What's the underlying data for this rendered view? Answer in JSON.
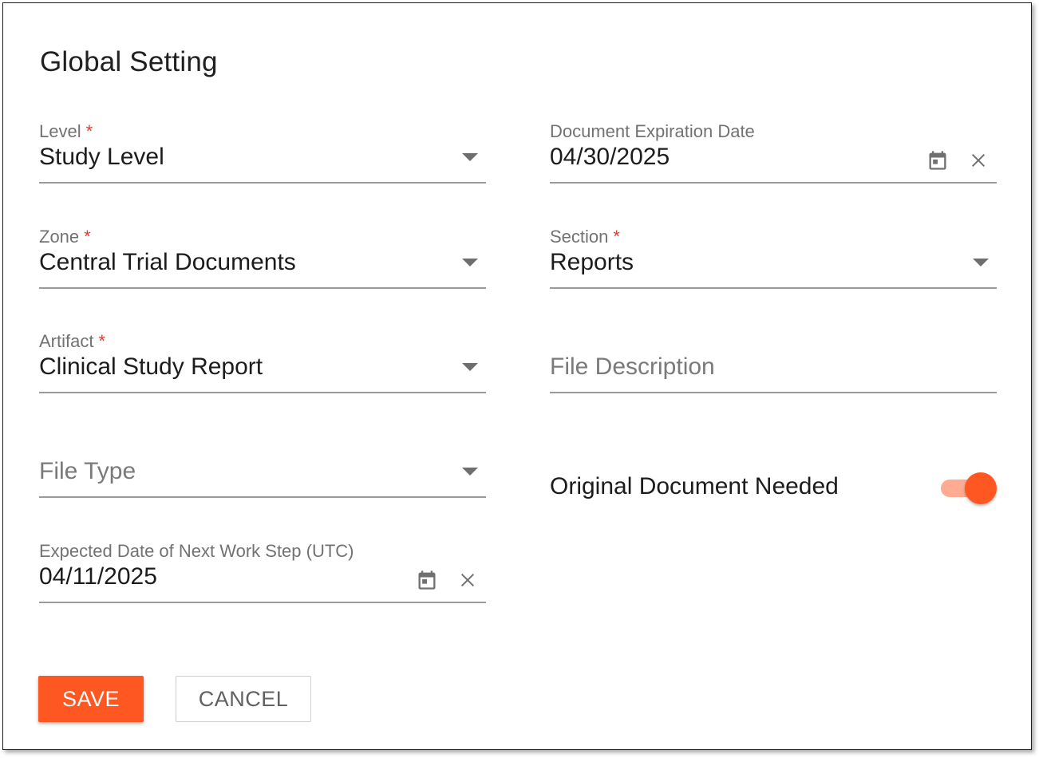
{
  "dialog": {
    "title": "Global Setting"
  },
  "colors": {
    "accent": "#ff5722",
    "accent_track": "#ffab91",
    "required": "#e53935"
  },
  "fields": {
    "level": {
      "label": "Level",
      "required": "*",
      "value": "Study Level",
      "icon": "chevron-down-icon"
    },
    "zone": {
      "label": "Zone",
      "required": "*",
      "value": "Central Trial Documents",
      "icon": "chevron-down-icon"
    },
    "artifact": {
      "label": "Artifact",
      "required": "*",
      "value": "Clinical Study Report",
      "icon": "chevron-down-icon"
    },
    "file_type": {
      "placeholder": "File Type",
      "icon": "chevron-down-icon"
    },
    "expected_date": {
      "label": "Expected Date of Next Work Step (UTC)",
      "value": "04/11/2025",
      "icons": [
        "calendar-icon",
        "close-icon"
      ]
    },
    "expiration_date": {
      "label": "Document Expiration Date",
      "value": "04/30/2025",
      "icons": [
        "calendar-icon",
        "close-icon"
      ]
    },
    "section": {
      "label": "Section",
      "required": "*",
      "value": "Reports",
      "icon": "chevron-down-icon"
    },
    "file_description": {
      "placeholder": "File Description"
    }
  },
  "toggle": {
    "label": "Original Document Needed",
    "on": true
  },
  "buttons": {
    "save": "SAVE",
    "cancel": "CANCEL"
  }
}
